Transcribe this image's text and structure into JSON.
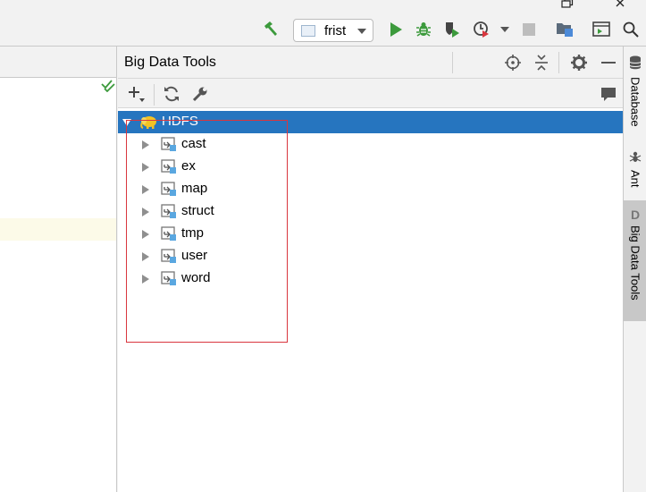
{
  "toolbar": {
    "run_config_label": "frist"
  },
  "tool_window": {
    "title": "Big Data Tools"
  },
  "tree": {
    "root_label": "HDFS",
    "items": [
      {
        "label": "cast"
      },
      {
        "label": "ex"
      },
      {
        "label": "map"
      },
      {
        "label": "struct"
      },
      {
        "label": "tmp"
      },
      {
        "label": "user"
      },
      {
        "label": "word"
      }
    ]
  },
  "right_strip": {
    "tabs": [
      {
        "label": "Database",
        "icon": "database-icon"
      },
      {
        "label": "Ant",
        "icon": "ant-icon"
      },
      {
        "label": "Big Data Tools",
        "icon": "big-data-tools-icon",
        "glyph": "D"
      }
    ]
  },
  "colors": {
    "selection": "#2675bf",
    "highlight_box": "#d9363e",
    "run": "#3c9a3c",
    "debug": "#3c9a3c"
  }
}
